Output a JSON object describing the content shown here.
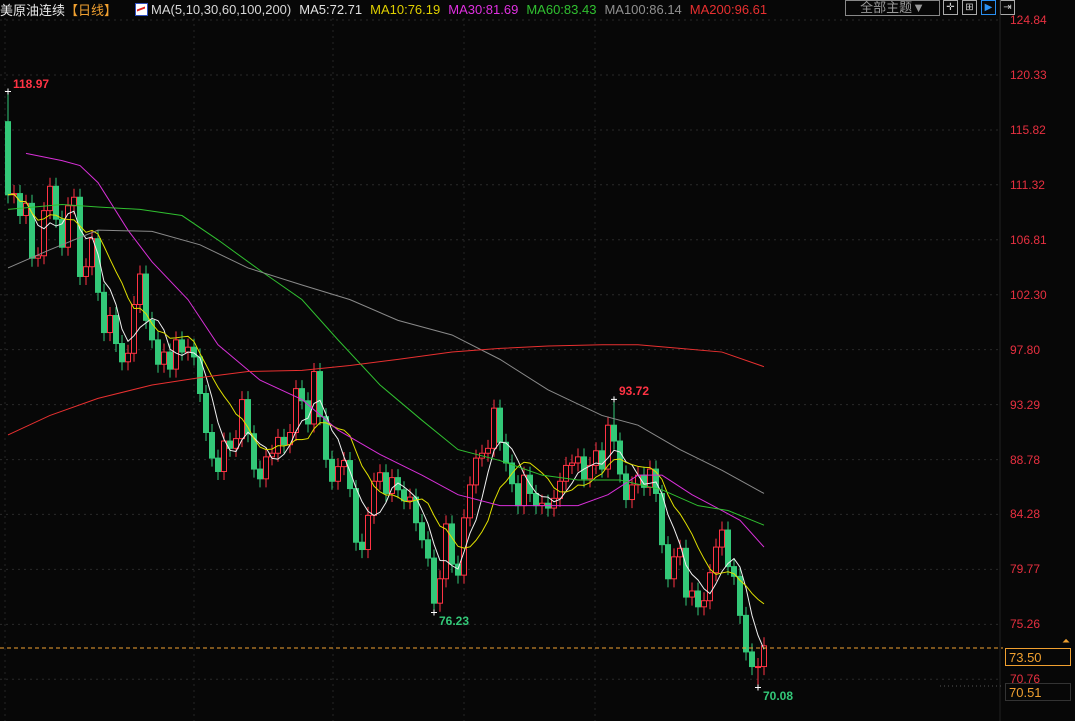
{
  "header": {
    "title": "美原油连续",
    "period": "【日线】",
    "ma_label": "MA(5,10,30,60,100,200)",
    "ma_values": [
      {
        "text": "MA5:72.71",
        "color": "#e0e0e0"
      },
      {
        "text": "MA10:76.19",
        "color": "#e0d000"
      },
      {
        "text": "MA30:81.69",
        "color": "#e030e0"
      },
      {
        "text": "MA60:83.43",
        "color": "#30c030"
      },
      {
        "text": "MA100:86.14",
        "color": "#909090"
      },
      {
        "text": "MA200:96.61",
        "color": "#e83030"
      }
    ]
  },
  "toolbar": {
    "theme_label": "全部主题▼",
    "buttons": [
      {
        "icon": "crosshair-icon",
        "glyph": "✛",
        "active": false
      },
      {
        "icon": "chart-range-icon",
        "glyph": "⊞",
        "active": false
      },
      {
        "icon": "play-right-icon",
        "glyph": "▶",
        "active": true
      },
      {
        "icon": "move-right-icon",
        "glyph": "⇥",
        "active": false
      }
    ]
  },
  "chart_data": {
    "type": "candlestick",
    "up_color": "#ff3344",
    "down_color": "#33c878",
    "ylim": [
      68.5,
      125.6
    ],
    "y_ticks": [
      "124.84",
      "120.33",
      "115.82",
      "111.32",
      "106.81",
      "102.30",
      "97.80",
      "93.29",
      "88.78",
      "84.28",
      "79.77",
      "75.26",
      "70.76"
    ],
    "close": [
      110.5,
      110.6,
      108.8,
      109.8,
      105.3,
      105.5,
      109.2,
      111.2,
      108.5,
      106.2,
      109.6,
      110.3,
      103.8,
      104.6,
      106.9,
      102.5,
      99.2,
      100.6,
      98.3,
      96.8,
      97.5,
      101.5,
      104.0,
      100.2,
      98.6,
      96.6,
      97.6,
      96.2,
      98.6,
      97.6,
      98.0,
      97.2,
      94.2,
      91.0,
      88.9,
      87.8,
      90.3,
      89.7,
      90.5,
      93.7,
      90.9,
      88.0,
      87.2,
      89.0,
      89.3,
      90.6,
      90.0,
      91.0,
      94.6,
      93.6,
      91.7,
      96.0,
      92.3,
      88.8,
      87.0,
      88.2,
      88.7,
      86.4,
      82.0,
      81.4,
      84.2,
      87.0,
      87.7,
      86.0,
      87.3,
      86.3,
      85.4,
      85.7,
      83.6,
      82.2,
      80.7,
      77.0,
      79.0,
      83.5,
      80.2,
      79.3,
      84.0,
      86.7,
      88.9,
      89.3,
      89.7,
      93.0,
      90.2,
      88.5,
      86.8,
      85.0,
      87.5,
      86.0,
      85.0,
      85.2,
      84.8,
      85.6,
      87.0,
      88.3,
      88.5,
      89.0,
      87.2,
      88.3,
      89.5,
      88.0,
      91.6,
      90.3,
      87.6,
      85.5,
      86.7,
      87.5,
      86.5,
      88.0,
      86.0,
      81.8,
      79.0,
      80.8,
      81.5,
      77.5,
      78.0,
      76.7,
      77.2,
      79.5,
      81.6,
      83.0,
      80.0,
      79.2,
      76.0,
      73.0,
      71.8,
      71.8,
      73.5
    ],
    "ma_lines": [
      {
        "name": "MA30",
        "color": "#d830d8",
        "points": [
          [
            3,
            113.9
          ],
          [
            9,
            113.3
          ],
          [
            12,
            112.9
          ],
          [
            15,
            111.5
          ],
          [
            20,
            107.6
          ],
          [
            24,
            105.0
          ],
          [
            30,
            101.9
          ],
          [
            35,
            98.2
          ],
          [
            42,
            95.3
          ],
          [
            49,
            93.7
          ],
          [
            55,
            91.2
          ],
          [
            62,
            89.2
          ],
          [
            69,
            87.5
          ],
          [
            75,
            85.9
          ],
          [
            82,
            85.0
          ],
          [
            89,
            85.0
          ],
          [
            95,
            85.0
          ],
          [
            100,
            85.9
          ],
          [
            105,
            87.5
          ],
          [
            109,
            87.5
          ],
          [
            114,
            85.9
          ],
          [
            119,
            84.6
          ],
          [
            122,
            83.8
          ],
          [
            126,
            81.6
          ]
        ]
      },
      {
        "name": "MA60",
        "color": "#30c030",
        "points": [
          [
            0,
            109.3
          ],
          [
            9,
            109.7
          ],
          [
            15,
            109.5
          ],
          [
            22,
            109.3
          ],
          [
            29,
            108.8
          ],
          [
            35,
            106.8
          ],
          [
            42,
            104.3
          ],
          [
            49,
            101.9
          ],
          [
            55,
            98.6
          ],
          [
            62,
            94.9
          ],
          [
            69,
            92.0
          ],
          [
            75,
            89.6
          ],
          [
            82,
            88.7
          ],
          [
            89,
            87.5
          ],
          [
            95,
            87.1
          ],
          [
            102,
            87.1
          ],
          [
            109,
            86.3
          ],
          [
            115,
            85.0
          ],
          [
            120,
            84.6
          ],
          [
            126,
            83.4
          ]
        ]
      },
      {
        "name": "MA100",
        "color": "#8a8a8a",
        "points": [
          [
            0,
            104.5
          ],
          [
            7,
            106.0
          ],
          [
            15,
            107.6
          ],
          [
            24,
            107.5
          ],
          [
            32,
            106.4
          ],
          [
            40,
            104.5
          ],
          [
            49,
            103.1
          ],
          [
            57,
            101.9
          ],
          [
            65,
            100.2
          ],
          [
            74,
            99.0
          ],
          [
            82,
            97.0
          ],
          [
            90,
            94.5
          ],
          [
            99,
            92.4
          ],
          [
            105,
            91.6
          ],
          [
            112,
            89.6
          ],
          [
            119,
            87.9
          ],
          [
            126,
            86.0
          ]
        ]
      },
      {
        "name": "MA200",
        "color": "#e83030",
        "points": [
          [
            0,
            90.8
          ],
          [
            7,
            92.4
          ],
          [
            15,
            93.8
          ],
          [
            24,
            94.9
          ],
          [
            32,
            95.5
          ],
          [
            40,
            96.0
          ],
          [
            49,
            96.1
          ],
          [
            57,
            96.5
          ],
          [
            65,
            97.0
          ],
          [
            74,
            97.6
          ],
          [
            82,
            97.9
          ],
          [
            90,
            98.1
          ],
          [
            99,
            98.2
          ],
          [
            105,
            98.2
          ],
          [
            112,
            97.9
          ],
          [
            119,
            97.6
          ],
          [
            126,
            96.4
          ]
        ]
      }
    ],
    "ma5_color": "#f0f0f0",
    "ma10_color": "#e0e000",
    "annotations": [
      {
        "text": "118.97",
        "index": 0,
        "price": 118.97,
        "color": "#ff3344"
      },
      {
        "text": "93.72",
        "index": 101,
        "price": 93.72,
        "color": "#ff3344"
      },
      {
        "text": "76.23",
        "index": 71,
        "price": 76.23,
        "color": "#33c878"
      },
      {
        "text": "70.08",
        "index": 125,
        "price": 70.08,
        "color": "#33c878"
      }
    ],
    "last_price": "73.50",
    "last_price_value": 73.5,
    "cursor_price": "70.51"
  }
}
